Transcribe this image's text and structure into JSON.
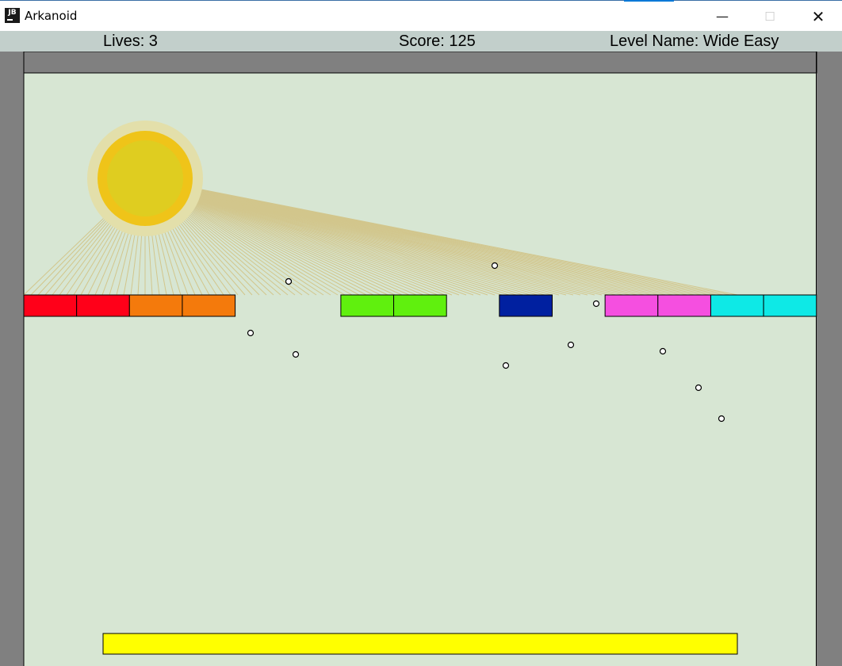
{
  "window": {
    "title": "Arkanoid",
    "icon_text": "JB",
    "icon": "jetbrains-logo-icon",
    "controls": {
      "minimize_icon": "minimize-icon",
      "maximize_icon": "maximize-icon",
      "close_icon": "close-icon"
    }
  },
  "hud": {
    "lives": "Lives: 3",
    "score": "Score: 125",
    "level": "Level Name: Wide Easy"
  },
  "game": {
    "colors": {
      "background": "#d7e6d3",
      "border": "#808080",
      "sun_halo": "#e3dfaa",
      "sun_ring": "#efc419",
      "sun_core": "#dfcd20",
      "rays": "#d2c68c",
      "paddle": "#ffff00",
      "ball": "#ffffff"
    },
    "bricks": [
      {
        "color": "#ff0019"
      },
      {
        "color": "#ff0019"
      },
      {
        "color": "#f47a0c"
      },
      {
        "color": "#f47a0c"
      },
      null,
      null,
      {
        "color": "#60f00e"
      },
      {
        "color": "#60f00e"
      },
      null,
      {
        "color": "#0020a0"
      },
      null,
      {
        "color": "#f54fe0"
      },
      {
        "color": "#f54fe0"
      },
      {
        "color": "#0ee9e6"
      },
      {
        "color": "#0ee9e6"
      }
    ],
    "ball_count": 11
  }
}
